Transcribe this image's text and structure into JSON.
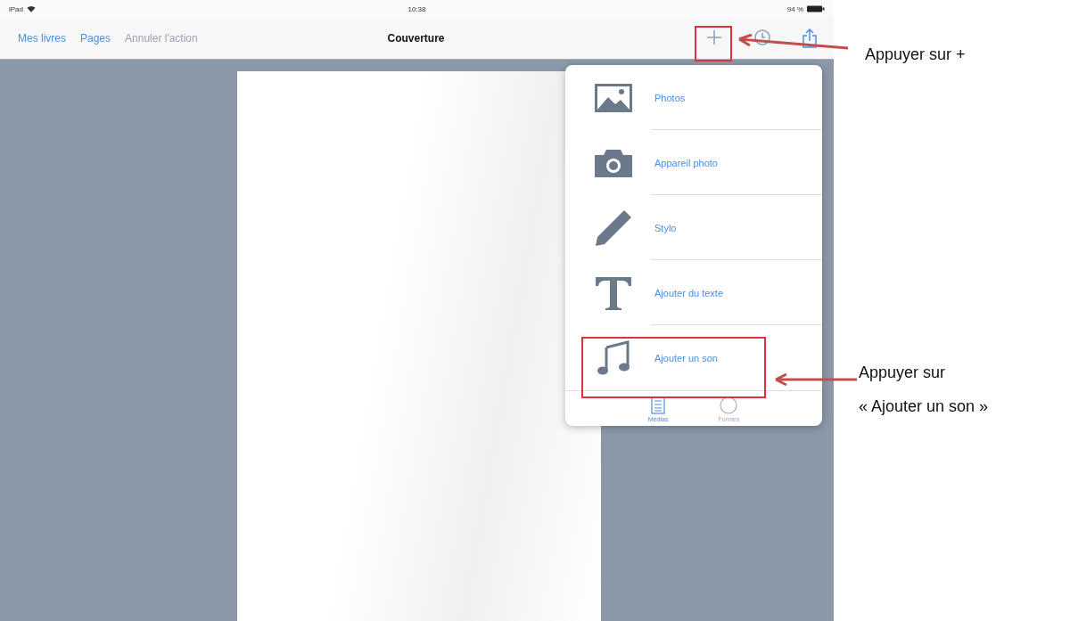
{
  "status_bar": {
    "carrier": "iPad",
    "time": "10:38",
    "battery": "94 %"
  },
  "nav_bar": {
    "left_buttons": [
      {
        "label": "Mes livres",
        "disabled": false
      },
      {
        "label": "Pages",
        "disabled": false
      },
      {
        "label": "Annuler l'action",
        "disabled": true
      }
    ],
    "title": "Couverture"
  },
  "add_menu": {
    "items": [
      {
        "kind": "photos",
        "label": "Photos"
      },
      {
        "kind": "camera",
        "label": "Appareil photo"
      },
      {
        "kind": "pen",
        "label": "Stylo"
      },
      {
        "kind": "text",
        "label": "Ajouter du texte"
      },
      {
        "kind": "sound",
        "label": "Ajouter un son"
      }
    ],
    "tabs": [
      {
        "kind": "list",
        "label": "Médias",
        "selected": true
      },
      {
        "kind": "circle",
        "label": "Formes",
        "selected": false
      }
    ]
  },
  "annotations": [
    {
      "lines": [
        "Appuyer sur +"
      ]
    },
    {
      "lines": [
        "Appuyer sur",
        "« Ajouter un son »"
      ]
    }
  ]
}
